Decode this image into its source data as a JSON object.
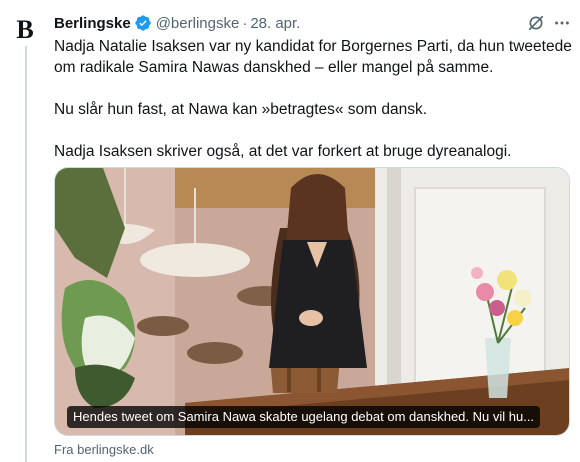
{
  "author": {
    "avatar_letter": "B",
    "name": "Berlingske",
    "handle": "@berlingske",
    "separator": "·",
    "date": "28. apr.",
    "verified_color": "#1d9bf0"
  },
  "icons": {
    "verified": "verified-badge-icon",
    "grok": "grok-icon",
    "more": "more-options-icon"
  },
  "tweet": {
    "paragraphs": [
      "Nadja Natalie Isaksen var ny kandidat for Borgernes Parti, da hun tweetede om radikale Samira Nawas danskhed – eller mangel på samme.",
      "Nu slår hun fast, at Nawa kan »betragtes« som dansk.",
      "Nadja Isaksen skriver også, at det var forkert at bruge dyreanalogi."
    ]
  },
  "card": {
    "caption": "Hendes tweet om Samira Nawa skabte ugelang debat om danskhed. Nu vil hu...",
    "source": "Fra berlingske.dk"
  }
}
